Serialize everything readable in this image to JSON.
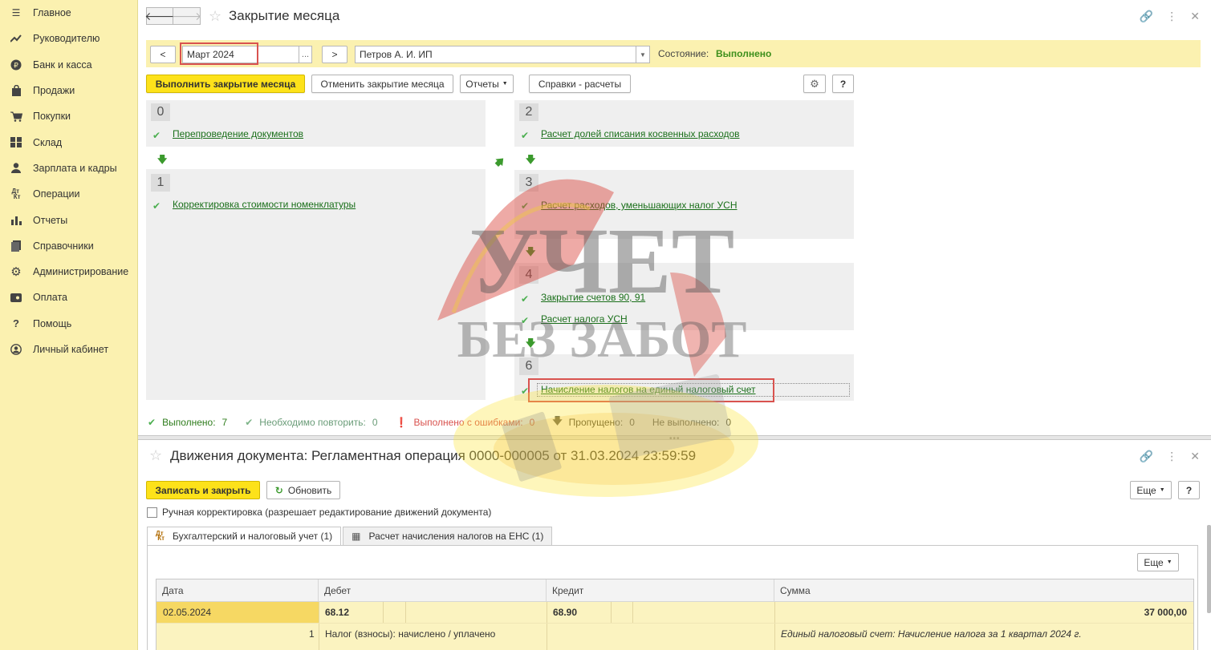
{
  "sidebar": {
    "items": [
      {
        "label": "Главное",
        "icon": "menu-icon"
      },
      {
        "label": "Руководителю",
        "icon": "trend-icon"
      },
      {
        "label": "Банк и касса",
        "icon": "ruble-icon"
      },
      {
        "label": "Продажи",
        "icon": "bag-icon"
      },
      {
        "label": "Покупки",
        "icon": "cart-icon"
      },
      {
        "label": "Склад",
        "icon": "warehouse-icon"
      },
      {
        "label": "Зарплата и кадры",
        "icon": "person-icon"
      },
      {
        "label": "Операции",
        "icon": "dt-kt-icon"
      },
      {
        "label": "Отчеты",
        "icon": "bar-chart-icon"
      },
      {
        "label": "Справочники",
        "icon": "book-icon"
      },
      {
        "label": "Администрирование",
        "icon": "gear-icon"
      },
      {
        "label": "Оплата",
        "icon": "payment-icon"
      },
      {
        "label": "Помощь",
        "icon": "question-icon"
      },
      {
        "label": "Личный кабинет",
        "icon": "account-icon"
      }
    ]
  },
  "top_form": {
    "title": "Закрытие месяца",
    "prev_label": "<",
    "next_label": ">",
    "period": "Март 2024",
    "period_dots": "...",
    "organization": "Петров А. И. ИП",
    "state_label": "Состояние:",
    "state_value": "Выполнено",
    "toolbar": {
      "execute": "Выполнить закрытие месяца",
      "cancel": "Отменить закрытие месяца",
      "reports": "Отчеты",
      "references": "Справки - расчеты",
      "help": "?"
    },
    "steps": {
      "s0": {
        "num": "0",
        "links": [
          "Перепроведение документов"
        ]
      },
      "s1": {
        "num": "1",
        "links": [
          "Корректировка стоимости номенклатуры"
        ]
      },
      "s2": {
        "num": "2",
        "links": [
          "Расчет долей списания косвенных расходов"
        ]
      },
      "s3": {
        "num": "3",
        "links": [
          "Расчет расходов, уменьшающих налог УСН"
        ]
      },
      "s4": {
        "num": "4",
        "links": [
          "Закрытие счетов 90, 91",
          "Расчет налога УСН"
        ]
      },
      "s6": {
        "num": "6",
        "links": [
          "Начисление налогов на единый налоговый счет"
        ]
      }
    },
    "summary": {
      "done_label": "Выполнено:",
      "done_value": "7",
      "repeat_label": "Необходимо повторить:",
      "repeat_value": "0",
      "errors_label": "Выполнено с ошибками:",
      "errors_value": "0",
      "skipped_label": "Пропущено:",
      "skipped_value": "0",
      "not_done_label": "Не выполнено:",
      "not_done_value": "0"
    }
  },
  "bottom_form": {
    "title": "Движения документа: Регламентная операция 0000-000005 от 31.03.2024 23:59:59",
    "save_close": "Записать и закрыть",
    "refresh": "Обновить",
    "more": "Еще",
    "help": "?",
    "manual_label": "Ручная корректировка (разрешает редактирование движений документа)",
    "tabs": [
      {
        "label": "Бухгалтерский и налоговый учет (1)",
        "icon": "dt-kt-icon"
      },
      {
        "label": "Расчет начисления налогов на ЕНС (1)",
        "icon": "table-icon"
      }
    ],
    "tab_more": "Еще",
    "table": {
      "columns": [
        "Дата",
        "Дебет",
        "Кредит",
        "Сумма"
      ],
      "rows": [
        {
          "date": "02.05.2024",
          "debit": "68.12",
          "credit": "68.90",
          "sum": "37 000,00",
          "line": "1",
          "debit_sub": "Налог (взносы): начислено / уплачено",
          "content": "Единый налоговый счет: Начисление налога за 1 квартал 2024 г."
        }
      ]
    }
  },
  "watermark": {
    "line1": "УЧЕТ",
    "line2": "БЕЗ ЗАБОТ"
  },
  "colors": {
    "accent": "#fde21a",
    "sidebar": "#fbf1b0",
    "success": "#3d8f1b",
    "error": "#d9534f",
    "link": "#1a6f1a"
  }
}
